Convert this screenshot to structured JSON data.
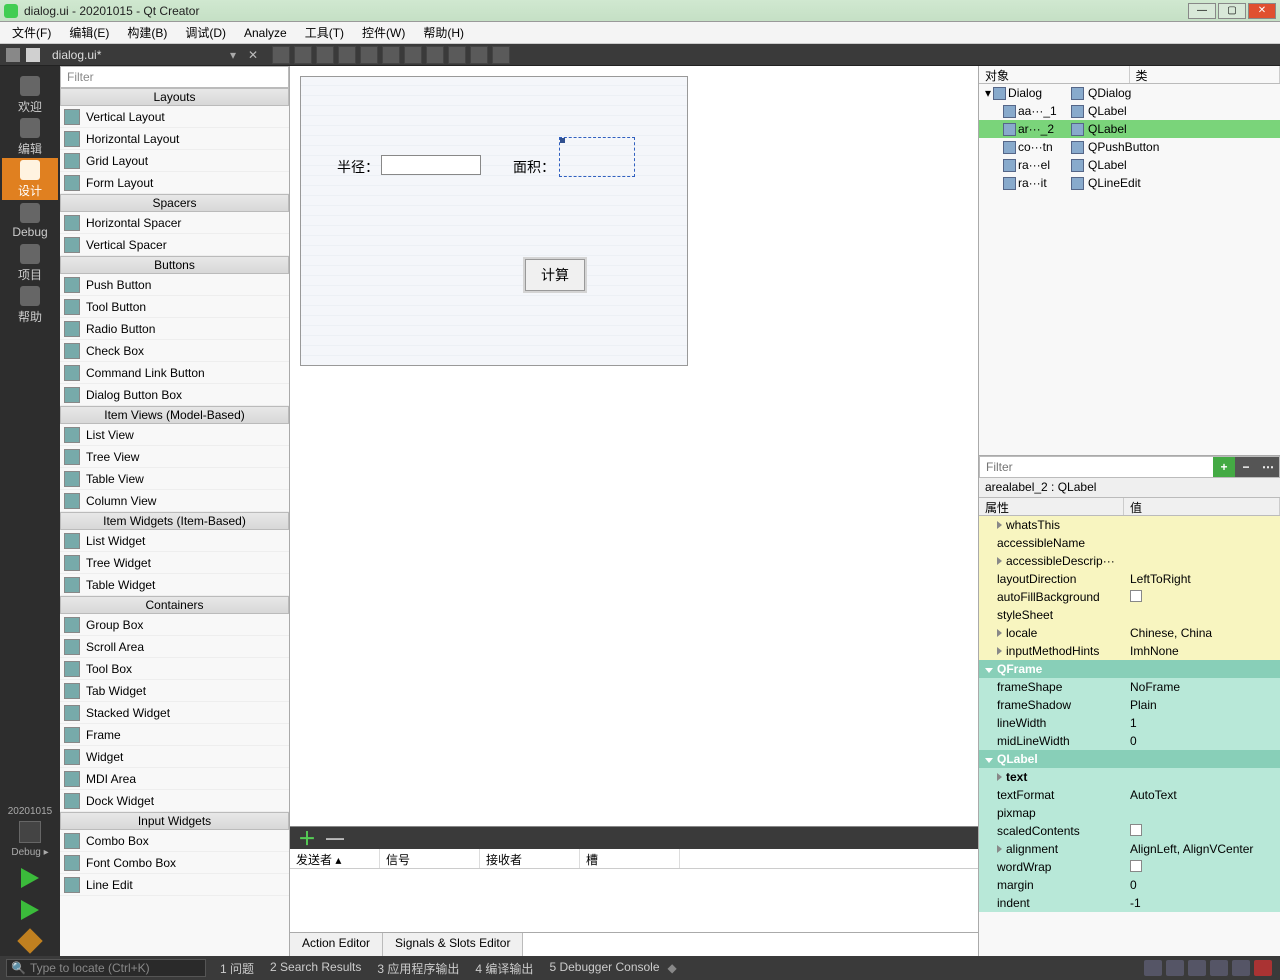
{
  "window": {
    "title": "dialog.ui - 20201015 - Qt Creator"
  },
  "menus": [
    "文件(F)",
    "编辑(E)",
    "构建(B)",
    "调试(D)",
    "Analyze",
    "工具(T)",
    "控件(W)",
    "帮助(H)"
  ],
  "tab": {
    "file": "dialog.ui*"
  },
  "leftbar": {
    "items": [
      "欢迎",
      "编辑",
      "设计",
      "Debug",
      "项目",
      "帮助"
    ],
    "active": 2,
    "kit": "20201015",
    "mode": "Debug"
  },
  "widgetbox": {
    "filter": "Filter",
    "groups": [
      {
        "hdr": "Layouts",
        "items": [
          "Vertical Layout",
          "Horizontal Layout",
          "Grid Layout",
          "Form Layout"
        ]
      },
      {
        "hdr": "Spacers",
        "items": [
          "Horizontal Spacer",
          "Vertical Spacer"
        ]
      },
      {
        "hdr": "Buttons",
        "items": [
          "Push Button",
          "Tool Button",
          "Radio Button",
          "Check Box",
          "Command Link Button",
          "Dialog Button Box"
        ]
      },
      {
        "hdr": "Item Views (Model-Based)",
        "items": [
          "List View",
          "Tree View",
          "Table View",
          "Column View"
        ]
      },
      {
        "hdr": "Item Widgets (Item-Based)",
        "items": [
          "List Widget",
          "Tree Widget",
          "Table Widget"
        ]
      },
      {
        "hdr": "Containers",
        "items": [
          "Group Box",
          "Scroll Area",
          "Tool Box",
          "Tab Widget",
          "Stacked Widget",
          "Frame",
          "Widget",
          "MDI Area",
          "Dock Widget"
        ]
      },
      {
        "hdr": "Input Widgets",
        "items": [
          "Combo Box",
          "Font Combo Box",
          "Line Edit"
        ]
      }
    ]
  },
  "canvas": {
    "label_radius": "半径：",
    "label_area": "面积：",
    "btn": "计算"
  },
  "signals": {
    "cols": [
      "发送者",
      "信号",
      "接收者",
      "槽"
    ],
    "tabs": [
      "Action Editor",
      "Signals & Slots Editor"
    ]
  },
  "objtree": {
    "hdr": [
      "对象",
      "类"
    ],
    "rows": [
      {
        "n": "Dialog",
        "c": "QDialog",
        "indent": 0,
        "open": true
      },
      {
        "n": "aa···_1",
        "c": "QLabel",
        "indent": 1
      },
      {
        "n": "ar···_2",
        "c": "QLabel",
        "indent": 1,
        "sel": true
      },
      {
        "n": "co···tn",
        "c": "QPushButton",
        "indent": 1
      },
      {
        "n": "ra···el",
        "c": "QLabel",
        "indent": 1
      },
      {
        "n": "ra···it",
        "c": "QLineEdit",
        "indent": 1
      }
    ]
  },
  "propfilter": "Filter",
  "selobj": "arealabel_2 : QLabel",
  "prophdr": [
    "属性",
    "值"
  ],
  "props": [
    {
      "n": "whatsThis",
      "v": "",
      "cls": "yellow",
      "tri": true
    },
    {
      "n": "accessibleName",
      "v": "",
      "cls": "yellow"
    },
    {
      "n": "accessibleDescrip···",
      "v": "",
      "cls": "yellow",
      "tri": true
    },
    {
      "n": "layoutDirection",
      "v": "LeftToRight",
      "cls": "yellow"
    },
    {
      "n": "autoFillBackground",
      "v": "[chk]",
      "cls": "yellow"
    },
    {
      "n": "styleSheet",
      "v": "",
      "cls": "yellow"
    },
    {
      "n": "locale",
      "v": "Chinese, China",
      "cls": "yellow",
      "tri": true
    },
    {
      "n": "inputMethodHints",
      "v": "ImhNone",
      "cls": "yellow",
      "tri": true
    },
    {
      "n": "QFrame",
      "v": "",
      "cls": "tealhdr",
      "tridn": true
    },
    {
      "n": "frameShape",
      "v": "NoFrame",
      "cls": "teal"
    },
    {
      "n": "frameShadow",
      "v": "Plain",
      "cls": "teal"
    },
    {
      "n": "lineWidth",
      "v": "1",
      "cls": "teal"
    },
    {
      "n": "midLineWidth",
      "v": "0",
      "cls": "teal"
    },
    {
      "n": "QLabel",
      "v": "",
      "cls": "tealhdr",
      "tridn": true
    },
    {
      "n": "text",
      "v": "",
      "cls": "teal",
      "tri": true,
      "bold": true
    },
    {
      "n": "textFormat",
      "v": "AutoText",
      "cls": "teal"
    },
    {
      "n": "pixmap",
      "v": "",
      "cls": "teal"
    },
    {
      "n": "scaledContents",
      "v": "[chk]",
      "cls": "teal"
    },
    {
      "n": "alignment",
      "v": "AlignLeft, AlignVCenter",
      "cls": "teal",
      "tri": true
    },
    {
      "n": "wordWrap",
      "v": "[chk]",
      "cls": "teal"
    },
    {
      "n": "margin",
      "v": "0",
      "cls": "teal"
    },
    {
      "n": "indent",
      "v": "-1",
      "cls": "teal"
    }
  ],
  "statusbar": {
    "search": "Type to locate (Ctrl+K)",
    "items": [
      "1  问题",
      "2  Search Results",
      "3  应用程序输出",
      "4  编译输出",
      "5  Debugger Console"
    ]
  }
}
